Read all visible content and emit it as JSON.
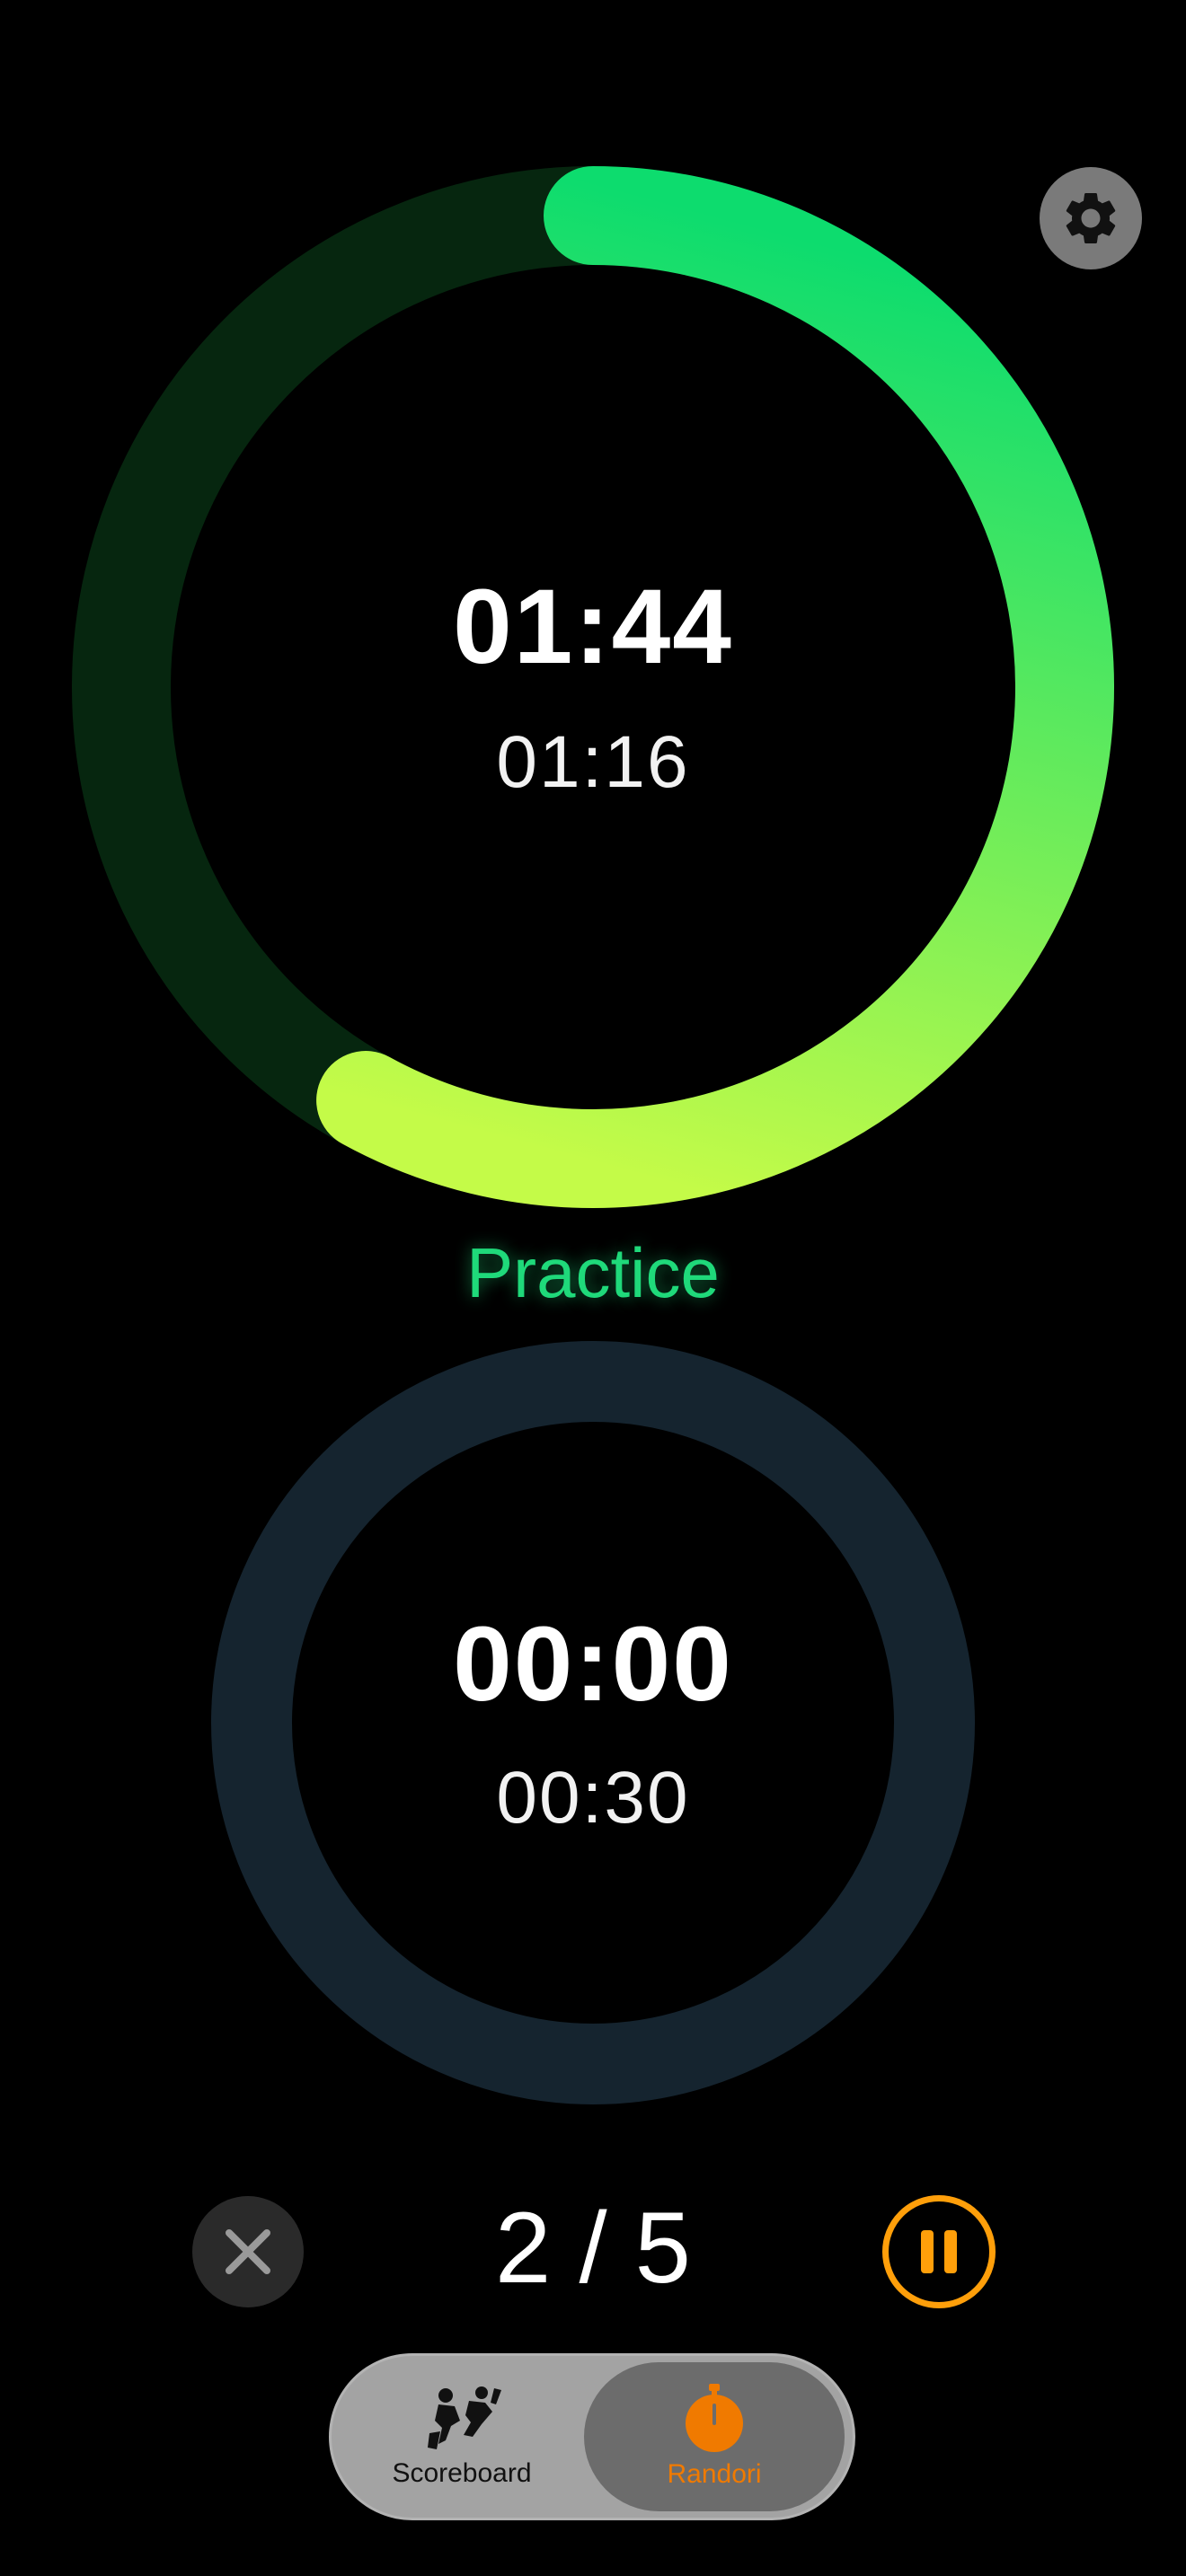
{
  "main_timer": {
    "elapsed": "01:44",
    "remaining": "01:16",
    "progress": 0.58,
    "ring_track_color": "#06260f",
    "gradient_start_color": "#0ddc6e",
    "gradient_end_color": "#c4fb48"
  },
  "phase": {
    "label": "Practice",
    "color": "#1fd97a"
  },
  "rest_timer": {
    "elapsed": "00:00",
    "remaining": "00:30",
    "progress": 0,
    "ring_track_color": "#15242f"
  },
  "controls": {
    "round_counter": "2 / 5",
    "close_icon": "xmark-icon",
    "pause_icon": "pause-icon",
    "settings_icon": "gear-icon",
    "accent_color": "#ff9f0a"
  },
  "tabbar": {
    "tabs": [
      {
        "label": "Scoreboard",
        "icon": "judo-throw-icon",
        "selected": false
      },
      {
        "label": "Randori",
        "icon": "stopwatch-icon",
        "selected": true
      }
    ]
  }
}
